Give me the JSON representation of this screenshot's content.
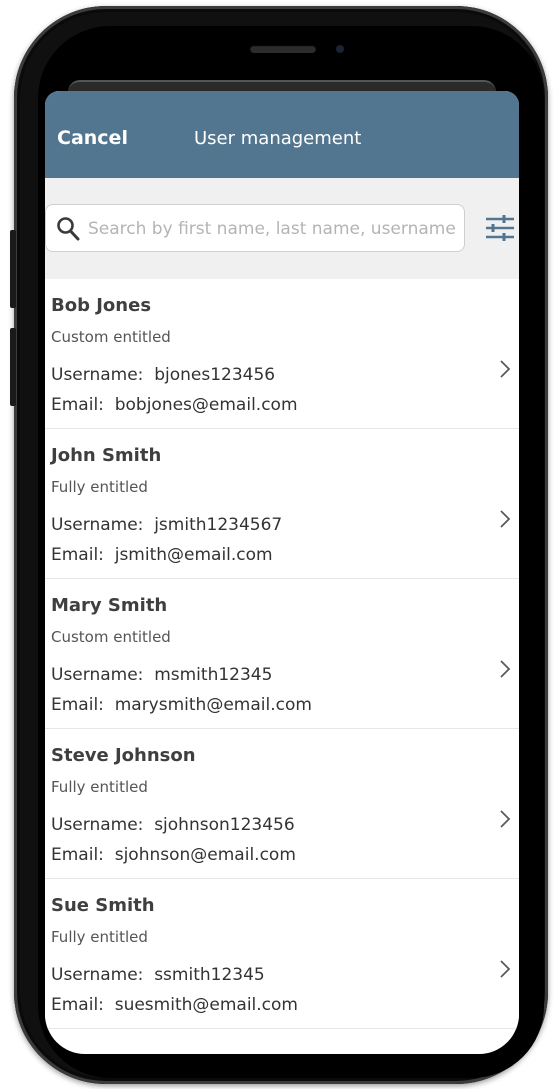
{
  "header": {
    "cancel_label": "Cancel",
    "title": "User management"
  },
  "search": {
    "placeholder": "Search by first name, last name, username"
  },
  "icons": {
    "search": "search-icon",
    "filter": "sliders-icon",
    "row": "chevron-right-icon"
  },
  "colors": {
    "header_bg": "#537690",
    "header_text": "#ffffff",
    "search_bar_bg": "#f0f0f0"
  },
  "labels": {
    "username": "Username:",
    "email": "Email:"
  },
  "users": [
    {
      "name": "Bob Jones",
      "entitlement": "Custom entitled",
      "username": "bjones123456",
      "email": "bobjones@email.com"
    },
    {
      "name": "John Smith",
      "entitlement": "Fully entitled",
      "username": "jsmith1234567",
      "email": "jsmith@email.com"
    },
    {
      "name": "Mary Smith",
      "entitlement": "Custom entitled",
      "username": "msmith12345",
      "email": "marysmith@email.com"
    },
    {
      "name": "Steve Johnson",
      "entitlement": "Fully entitled",
      "username": "sjohnson123456",
      "email": "sjohnson@email.com"
    },
    {
      "name": "Sue Smith",
      "entitlement": "Fully entitled",
      "username": "ssmith12345",
      "email": "suesmith@email.com"
    }
  ]
}
